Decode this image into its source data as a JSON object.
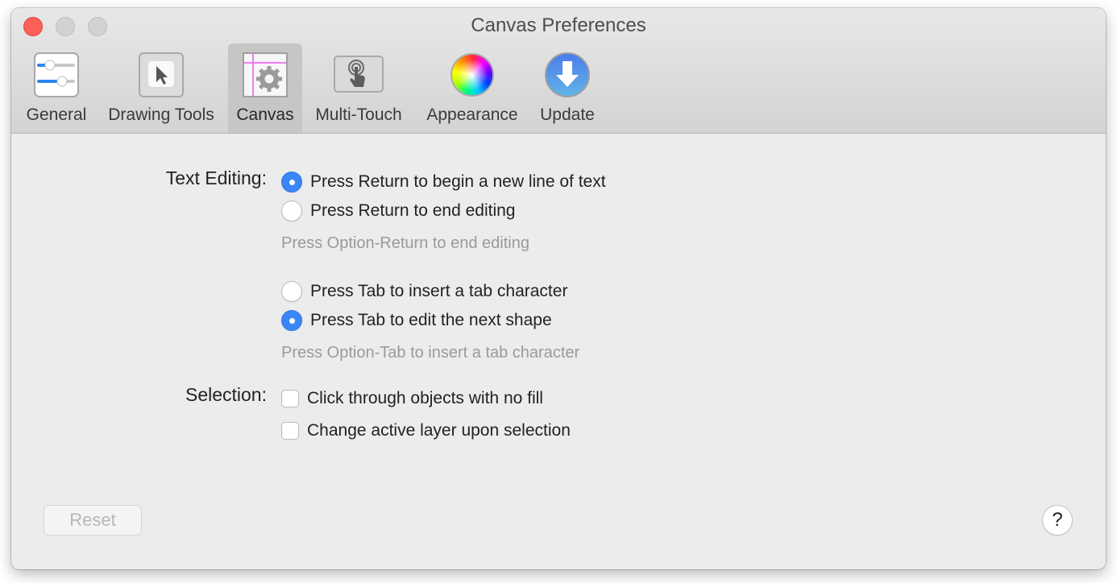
{
  "window": {
    "title": "Canvas Preferences",
    "traffic_lights": [
      "close",
      "minimize",
      "zoom"
    ]
  },
  "toolbar": {
    "items": [
      {
        "label": "General",
        "icon": "sliders-icon",
        "selected": false
      },
      {
        "label": "Drawing Tools",
        "icon": "pointer-arrow-icon",
        "selected": false
      },
      {
        "label": "Canvas",
        "icon": "canvas-gear-icon",
        "selected": true
      },
      {
        "label": "Multi-Touch",
        "icon": "touch-hand-icon",
        "selected": false
      },
      {
        "label": "Appearance",
        "icon": "color-wheel-icon",
        "selected": false
      },
      {
        "label": "Update",
        "icon": "download-arrow-icon",
        "selected": false
      }
    ]
  },
  "text_editing": {
    "label": "Text Editing:",
    "return_options": [
      {
        "label": "Press Return to begin a new line of text",
        "checked": true
      },
      {
        "label": "Press Return to end editing",
        "checked": false
      }
    ],
    "return_hint": "Press Option-Return to end editing",
    "tab_options": [
      {
        "label": "Press Tab to insert a tab character",
        "checked": false
      },
      {
        "label": "Press Tab to edit the next shape",
        "checked": true
      }
    ],
    "tab_hint": "Press Option-Tab to insert a tab character"
  },
  "selection": {
    "label": "Selection:",
    "options": [
      {
        "label": "Click through objects with no fill",
        "checked": false
      },
      {
        "label": "Change active layer upon selection",
        "checked": false
      }
    ]
  },
  "footer": {
    "reset_label": "Reset",
    "reset_enabled": false,
    "help_label": "?"
  },
  "colors": {
    "accent": "#3b86f7",
    "close": "#fe5f57",
    "hint_text": "#9a9a9a"
  }
}
